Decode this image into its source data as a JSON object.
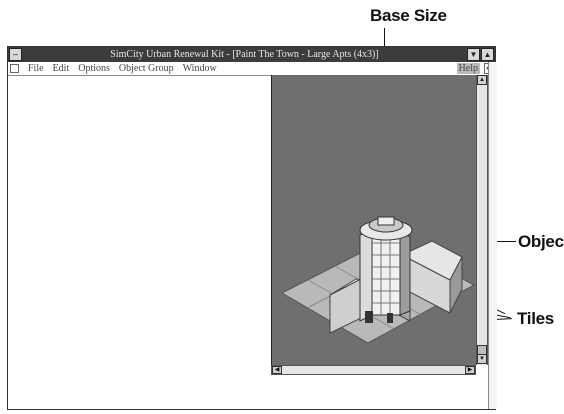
{
  "callouts": {
    "base_size": "Base Size",
    "object": "Object",
    "tiles": "Tiles"
  },
  "window": {
    "title": "SimCity Urban Renewal Kit - [Paint The Town - Large Apts (4x3)]",
    "menu": [
      "File",
      "Edit",
      "Options",
      "Object Group",
      "Window"
    ],
    "help": "Help"
  },
  "colors": {
    "titlebar": "#3c3c3c",
    "viewport_bg": "#6f6f6f"
  },
  "icons": {
    "system_menu": "dash-icon",
    "minimize": "triangle-down-icon",
    "maximize": "triangle-up-icon"
  }
}
